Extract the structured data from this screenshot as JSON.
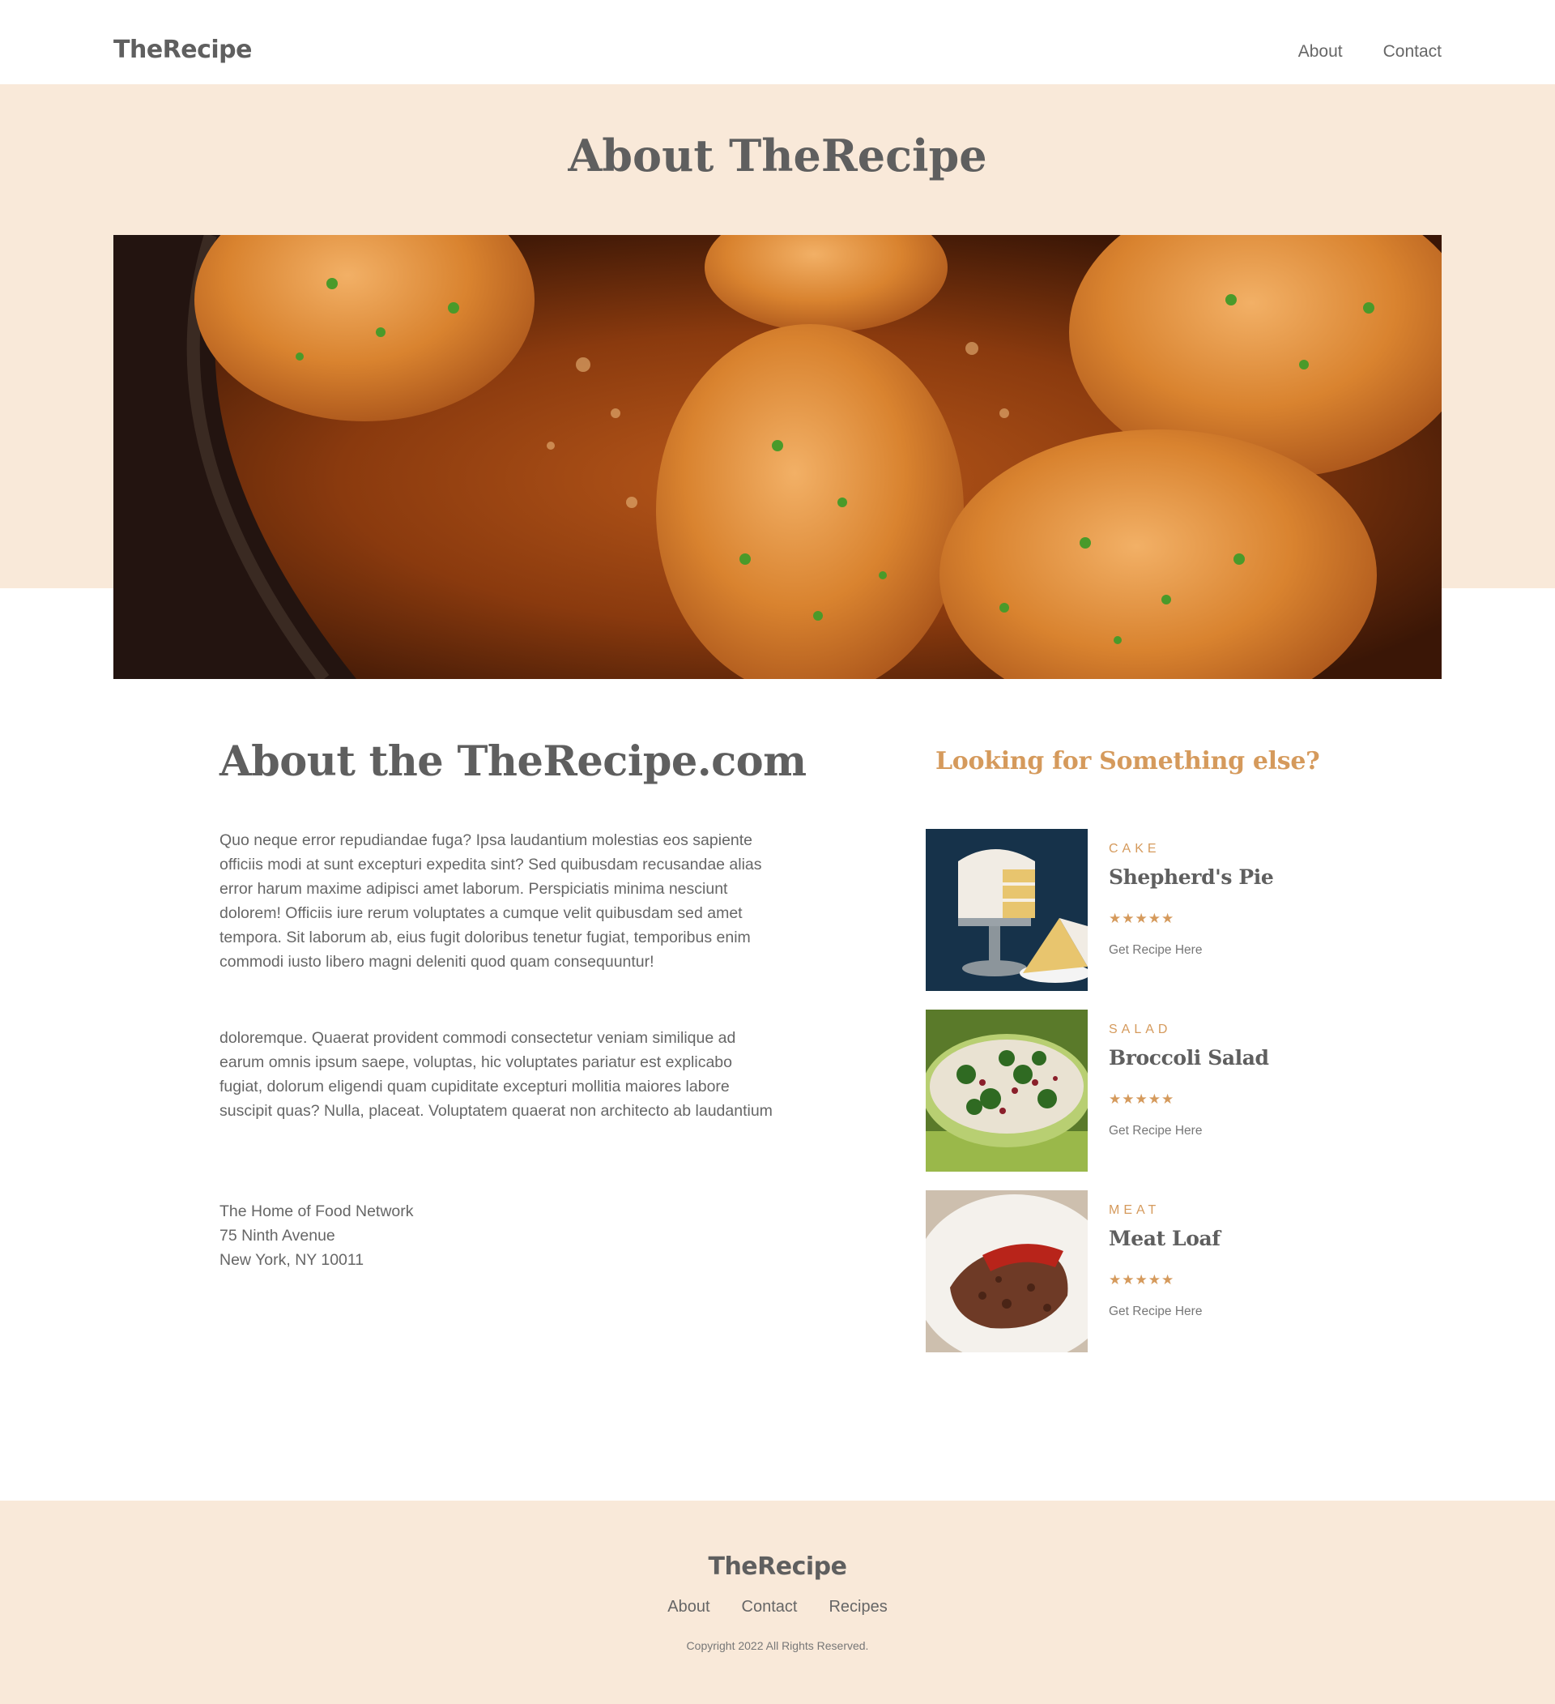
{
  "header": {
    "logo": "TheRecipe",
    "nav": [
      "About",
      "Contact"
    ]
  },
  "hero": {
    "title": "About TheRecipe",
    "image": "pan-seared-chicken-photo"
  },
  "about": {
    "title": "About the TheRecipe.com",
    "paragraphs": [
      "Quo neque error repudiandae fuga? Ipsa laudantium molestias eos sapiente officiis modi at sunt excepturi expedita sint? Sed quibusdam recusandae alias error harum maxime adipisci amet laborum. Perspiciatis minima nesciunt dolorem! Officiis iure rerum voluptates a cumque velit quibusdam sed amet tempora. Sit laborum ab, eius fugit doloribus tenetur fugiat, temporibus enim commodi iusto libero magni deleniti quod quam consequuntur!",
      "doloremque. Quaerat provident commodi consectetur veniam similique ad earum omnis ipsum saepe, voluptas, hic voluptates pariatur est explicabo fugiat, dolorum eligendi quam cupiditate excepturi mollitia maiores labore suscipit quas? Nulla, placeat. Voluptatem quaerat non architecto ab laudantium"
    ],
    "address": [
      "The Home of Food Network",
      "75 Ninth Avenue",
      "New York, NY 10011"
    ]
  },
  "sidebar": {
    "title": "Looking for Something else?",
    "cards": [
      {
        "category": "CAKE",
        "name": "Shepherd's Pie",
        "stars": "★★★★★",
        "rating": 5,
        "link": "Get Recipe Here",
        "image": "layer-cake-photo"
      },
      {
        "category": "SALAD",
        "name": "Broccoli Salad",
        "stars": "★★★★★",
        "rating": 5,
        "link": "Get Recipe Here",
        "image": "broccoli-salad-photo"
      },
      {
        "category": "MEAT",
        "name": "Meat Loaf",
        "stars": "★★★★★",
        "rating": 5,
        "link": "Get Recipe Here",
        "image": "meat-loaf-photo"
      }
    ]
  },
  "footer": {
    "logo": "TheRecipe",
    "nav": [
      "About",
      "Contact",
      "Recipes"
    ],
    "copyright": "Copyright 2022 All Rights Reserved."
  },
  "colors": {
    "accent": "#d59a5c",
    "band": "#f9e9d9",
    "text": "#5f5f5f"
  }
}
